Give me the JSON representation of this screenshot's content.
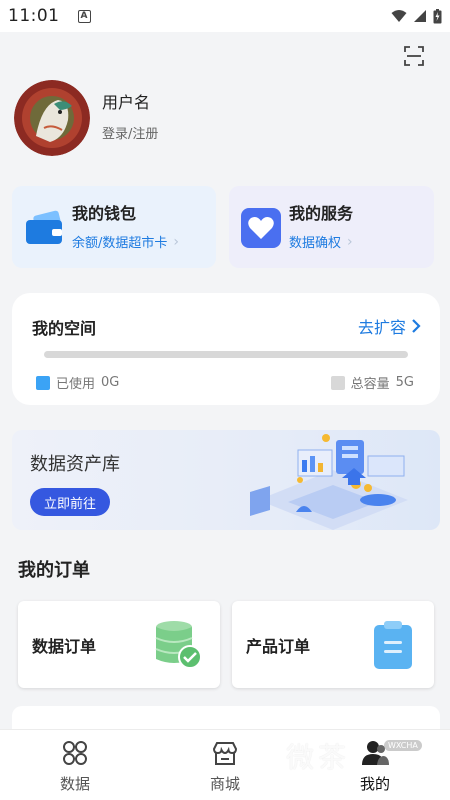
{
  "status_bar": {
    "time": "11:01",
    "notification_letter": "A"
  },
  "header": {
    "scan_icon": "scan-icon"
  },
  "profile": {
    "username": "用户名",
    "login_register": "登录/注册"
  },
  "wallet_card": {
    "title": "我的钱包",
    "subtitle": "余额/数据超市卡",
    "icon": "wallet-icon",
    "color": "#1e7be0"
  },
  "service_card": {
    "title": "我的服务",
    "subtitle": "数据确权",
    "icon": "heart-icon",
    "color": "#4a6ff0"
  },
  "space": {
    "title": "我的空间",
    "expand_label": "去扩容",
    "used_label": "已使用",
    "used_value": "0G",
    "total_label": "总容量",
    "total_value": "5G",
    "used_fraction": 0,
    "used_color": "#3ba3f5",
    "total_color": "#d8d8d8"
  },
  "banner": {
    "title": "数据资产库",
    "button_label": "立即前往"
  },
  "orders": {
    "title": "我的订单",
    "items": [
      {
        "label": "数据订单",
        "icon": "database-check-icon"
      },
      {
        "label": "产品订单",
        "icon": "clipboard-icon"
      }
    ]
  },
  "bottom_nav": {
    "items": [
      {
        "label": "数据",
        "icon": "grid-icon"
      },
      {
        "label": "商城",
        "icon": "store-icon"
      },
      {
        "label": "我的",
        "icon": "user-icon",
        "active": true
      }
    ]
  },
  "watermark": {
    "text": "微茶",
    "url": "WXCHA"
  }
}
